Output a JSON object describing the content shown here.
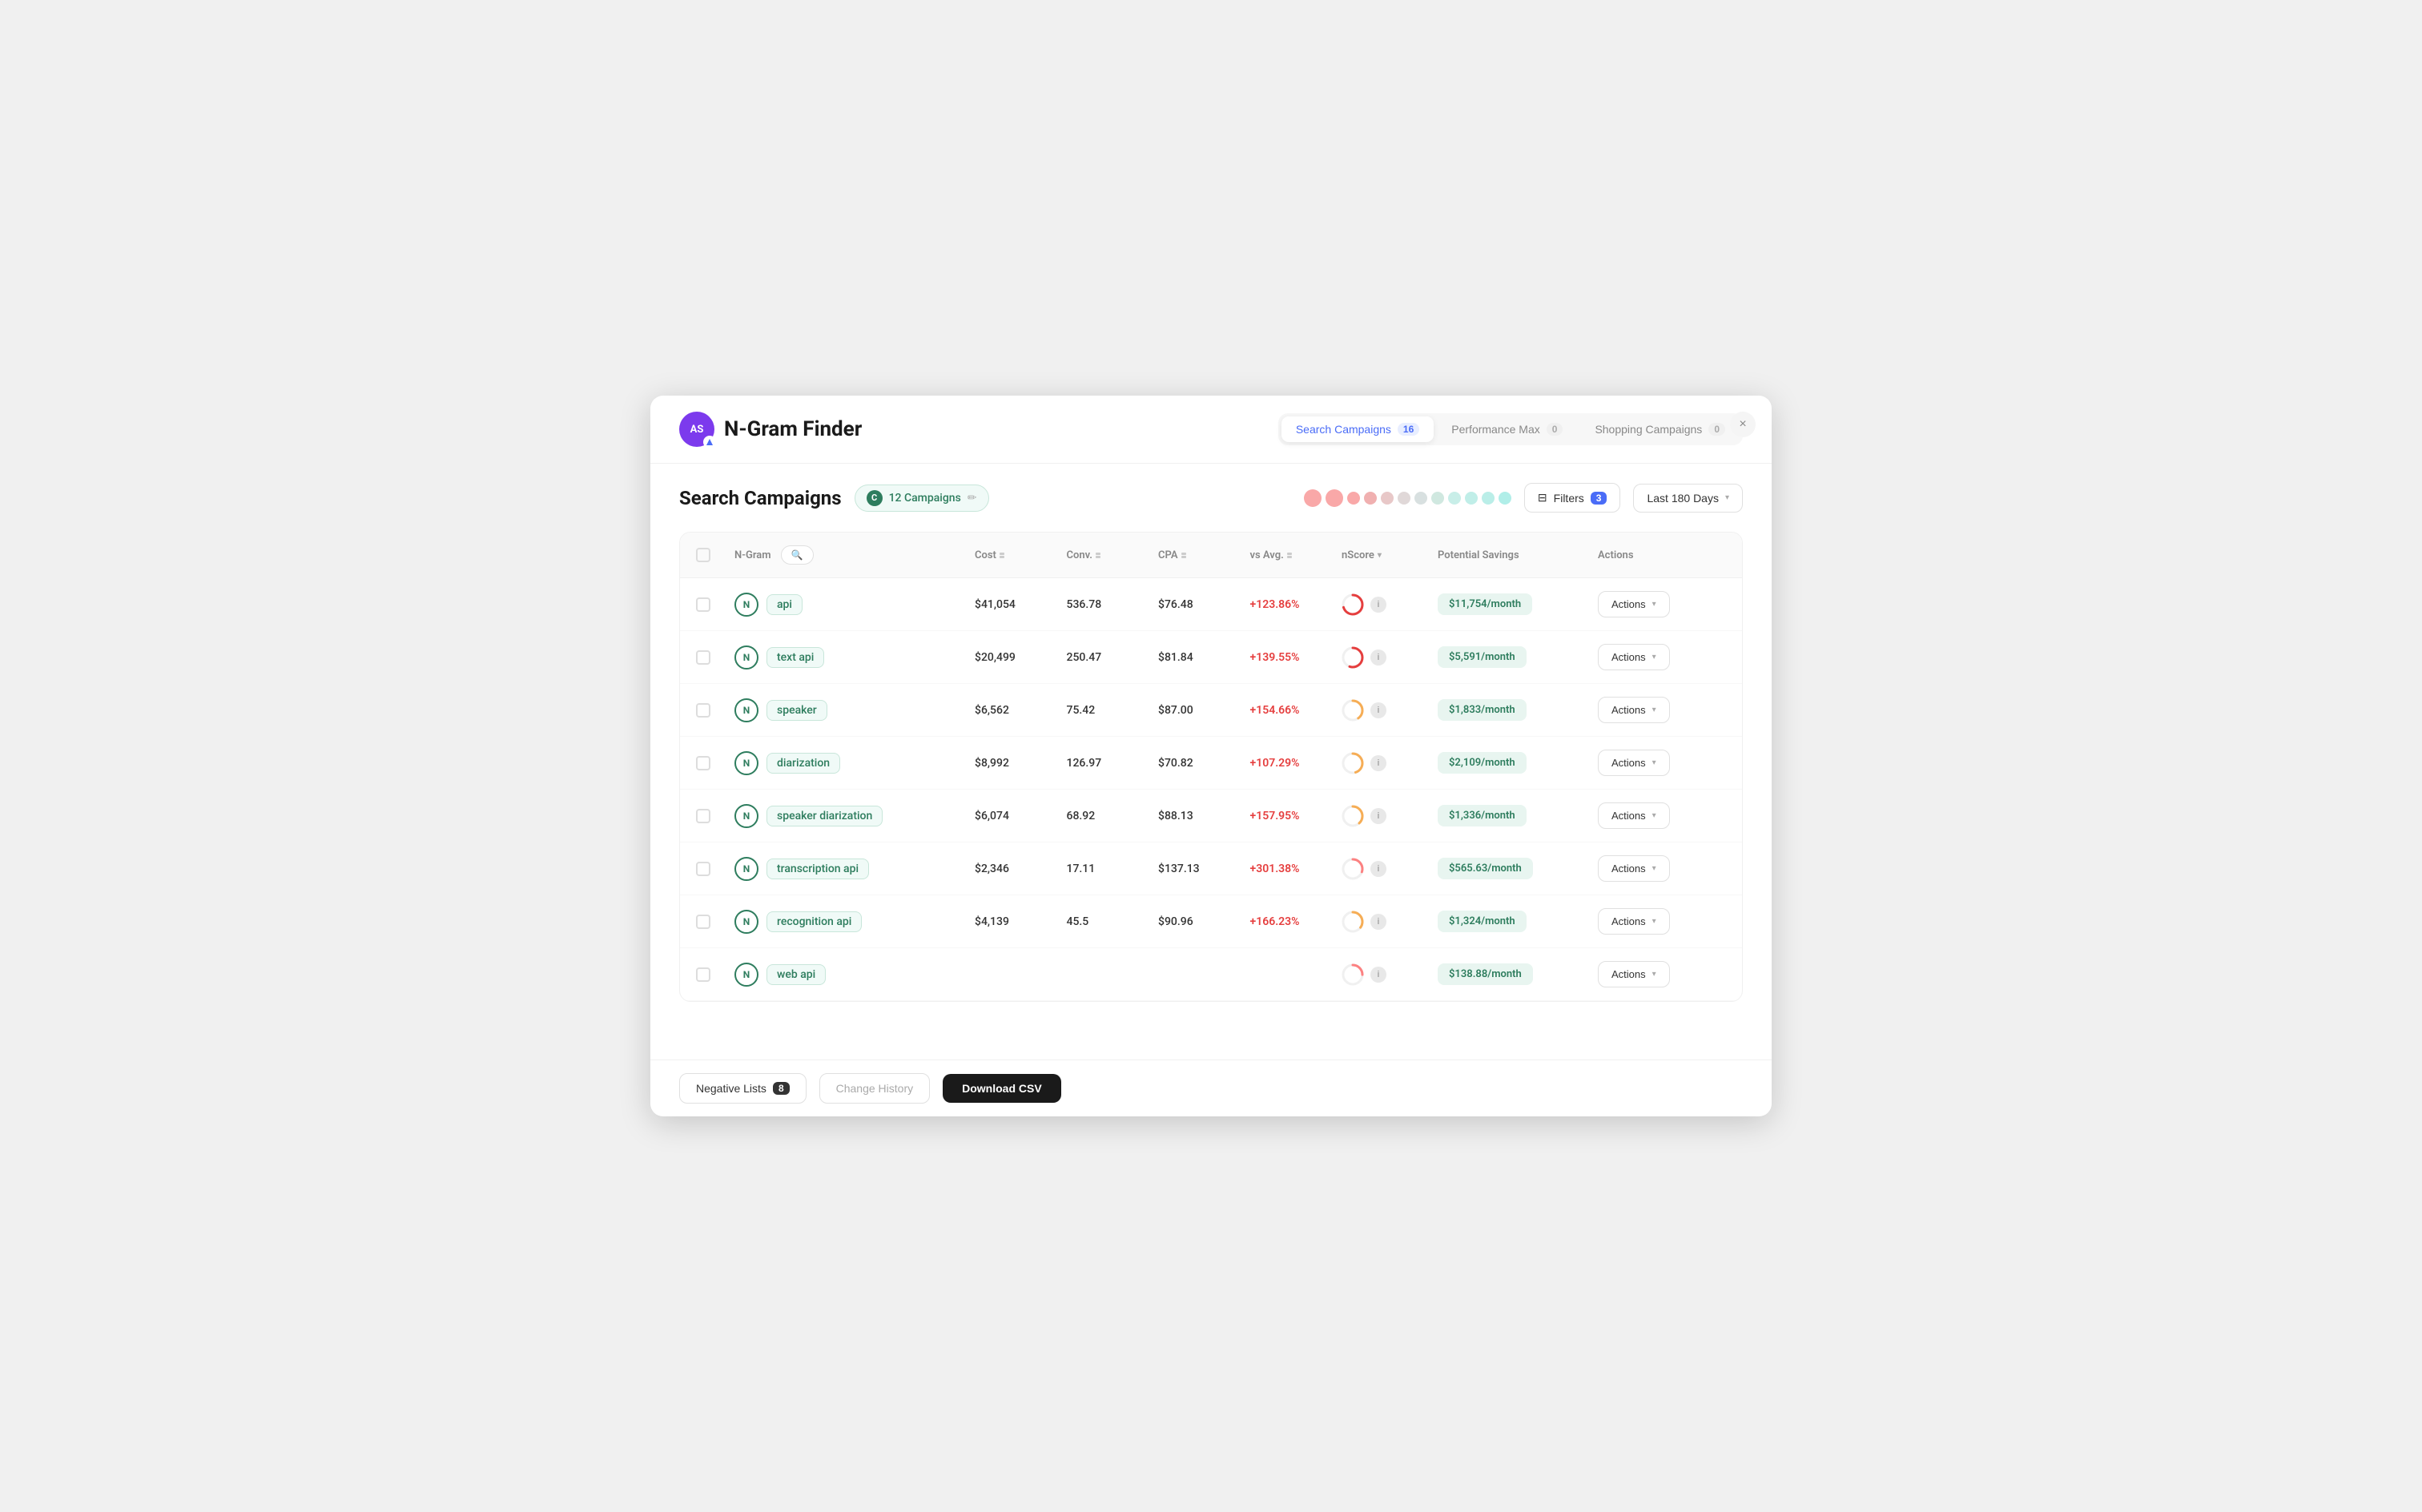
{
  "app": {
    "title": "N-Gram Finder",
    "close_label": "×",
    "avatar_initials": "AS"
  },
  "nav": {
    "tabs": [
      {
        "id": "search",
        "label": "Search Campaigns",
        "count": "16",
        "active": true
      },
      {
        "id": "pmax",
        "label": "Performance Max",
        "count": "0",
        "active": false
      },
      {
        "id": "shopping",
        "label": "Shopping Campaigns",
        "count": "0",
        "active": false
      }
    ]
  },
  "section": {
    "title": "Search Campaigns",
    "campaigns_label": "12 Campaigns",
    "edit_icon": "✏️",
    "filters_label": "Filters",
    "filters_count": "3",
    "date_label": "Last 180 Days"
  },
  "table": {
    "columns": {
      "ngram": "N-Gram",
      "cost": "Cost",
      "conv": "Conv.",
      "cpa": "CPA",
      "vs_avg": "vs Avg.",
      "nscore": "nScore",
      "potential_savings": "Potential Savings",
      "actions": "Actions"
    },
    "search_placeholder": "Search",
    "rows": [
      {
        "id": 1,
        "ngram": "api",
        "cost": "$41,054",
        "conv": "536.78",
        "cpa": "$76.48",
        "vs_avg": "+123.86%",
        "savings": "$11,754/month",
        "actions_label": "Actions",
        "ring_pct": 70
      },
      {
        "id": 2,
        "ngram": "text api",
        "cost": "$20,499",
        "conv": "250.47",
        "cpa": "$81.84",
        "vs_avg": "+139.55%",
        "savings": "$5,591/month",
        "actions_label": "Actions",
        "ring_pct": 55
      },
      {
        "id": 3,
        "ngram": "speaker",
        "cost": "$6,562",
        "conv": "75.42",
        "cpa": "$87.00",
        "vs_avg": "+154.66%",
        "savings": "$1,833/month",
        "actions_label": "Actions",
        "ring_pct": 40
      },
      {
        "id": 4,
        "ngram": "diarization",
        "cost": "$8,992",
        "conv": "126.97",
        "cpa": "$70.82",
        "vs_avg": "+107.29%",
        "savings": "$2,109/month",
        "actions_label": "Actions",
        "ring_pct": 45
      },
      {
        "id": 5,
        "ngram": "speaker diarization",
        "cost": "$6,074",
        "conv": "68.92",
        "cpa": "$88.13",
        "vs_avg": "+157.95%",
        "savings": "$1,336/month",
        "actions_label": "Actions",
        "ring_pct": 38
      },
      {
        "id": 6,
        "ngram": "transcription api",
        "cost": "$2,346",
        "conv": "17.11",
        "cpa": "$137.13",
        "vs_avg": "+301.38%",
        "savings": "$565.63/month",
        "actions_label": "Actions",
        "ring_pct": 30
      },
      {
        "id": 7,
        "ngram": "recognition api",
        "cost": "$4,139",
        "conv": "45.5",
        "cpa": "$90.96",
        "vs_avg": "+166.23%",
        "savings": "$1,324/month",
        "actions_label": "Actions",
        "ring_pct": 35
      },
      {
        "id": 8,
        "ngram": "web api",
        "cost": "",
        "conv": "",
        "cpa": "",
        "vs_avg": "",
        "savings": "$138.88/month",
        "actions_label": "Actions",
        "ring_pct": 25
      }
    ]
  },
  "bottom_bar": {
    "negative_lists_label": "Negative Lists",
    "negative_lists_count": "8",
    "change_history_label": "Change History",
    "download_csv_label": "Download CSV"
  },
  "dots": [
    {
      "color": "#f9a8a8",
      "size": "large"
    },
    {
      "color": "#f9a8a8",
      "size": "normal"
    },
    {
      "color": "#f9a8a8",
      "size": "normal"
    },
    {
      "color": "#f9a8a8",
      "size": "normal"
    },
    {
      "color": "#f0b0b0",
      "size": "normal"
    },
    {
      "color": "#e8d0d0",
      "size": "normal"
    },
    {
      "color": "#e0d8d8",
      "size": "normal"
    },
    {
      "color": "#d8e0e0",
      "size": "normal"
    },
    {
      "color": "#d0e8e0",
      "size": "normal"
    },
    {
      "color": "#c8e8e0",
      "size": "normal"
    },
    {
      "color": "#c0e8e0",
      "size": "normal"
    },
    {
      "color": "#b8e8e0",
      "size": "normal"
    }
  ]
}
